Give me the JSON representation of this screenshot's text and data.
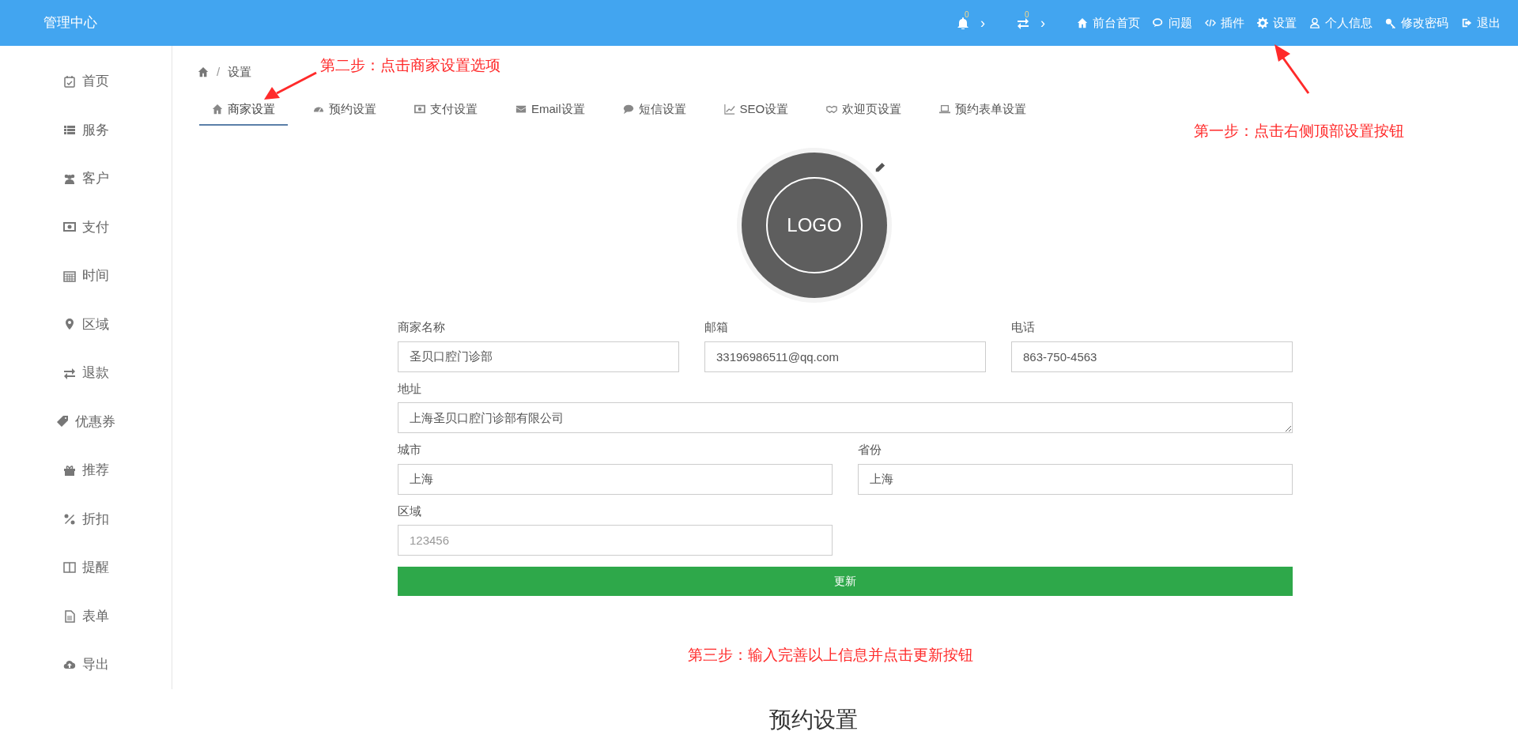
{
  "top_bar": {
    "title": "管理中心",
    "indicators": [
      {
        "badge": "0",
        "caret": "›"
      },
      {
        "badge": "0",
        "caret": "›"
      }
    ],
    "links": [
      "前台首页",
      "问题",
      "插件",
      "设置",
      "个人信息",
      "修改密码",
      "退出"
    ]
  },
  "sidebar": {
    "items": [
      "首页",
      "服务",
      "客户",
      "支付",
      "时间",
      "区域",
      "退款",
      "优惠券",
      "推荐",
      "折扣",
      "提醒",
      "表单",
      "导出"
    ]
  },
  "breadcrumb": {
    "separator": "/",
    "items": [
      "设置"
    ]
  },
  "tabs": [
    {
      "label": "商家设置",
      "selected": true
    },
    {
      "label": "预约设置",
      "selected": false
    },
    {
      "label": "支付设置",
      "selected": false
    },
    {
      "label": "Email设置",
      "selected": false
    },
    {
      "label": "短信设置",
      "selected": false
    },
    {
      "label": "SEO设置",
      "selected": false
    },
    {
      "label": "欢迎页设置",
      "selected": false
    },
    {
      "label": "预约表单设置",
      "selected": false
    }
  ],
  "logo": {
    "text": "LOGO"
  },
  "form_rows": [
    [
      {
        "label": "商家名称",
        "value": "圣贝口腔门诊部",
        "kind": "input"
      },
      {
        "label": "邮箱",
        "value": "33196986511@qq.com",
        "kind": "input"
      },
      {
        "label": "电话",
        "value": "863-750-4563",
        "kind": "input"
      }
    ],
    [
      {
        "label": "地址",
        "value": "上海圣贝口腔门诊部有限公司",
        "kind": "textarea"
      }
    ],
    [
      {
        "label": "城市",
        "value": "上海",
        "kind": "input"
      },
      {
        "label": "省份",
        "value": "上海",
        "kind": "input"
      }
    ],
    [
      {
        "label": "区域",
        "placeholder": "123456",
        "kind": "input"
      },
      {
        "kind": "spacer"
      }
    ]
  ],
  "submit_button": "更新",
  "section_heading": "预约设置",
  "annotations": [
    "第一步：点击右侧顶部设置按钮",
    "第二步：点击商家设置选项",
    "第三步：输入完善以上信息并点击更新按钮"
  ]
}
